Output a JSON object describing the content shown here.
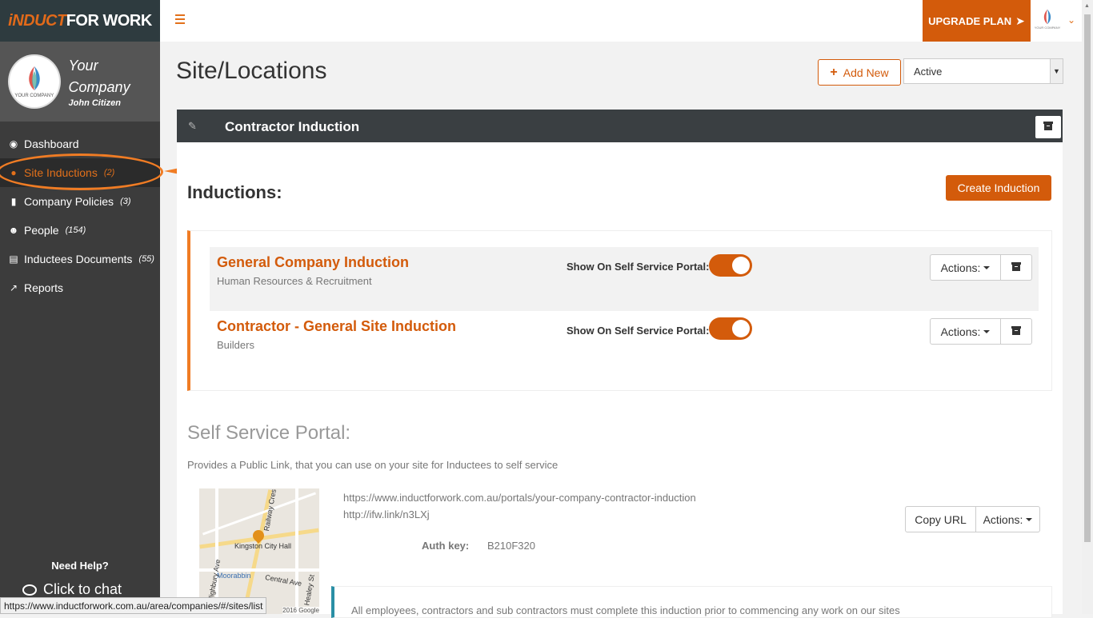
{
  "brand": {
    "part1": "iNDUCT",
    "part2": "FOR WORK"
  },
  "profile": {
    "company": "Your Company",
    "user": "John Citizen",
    "logo_text": "YOUR COMPANY"
  },
  "nav": [
    {
      "label": "Dashboard",
      "count": "",
      "icon": "dashboard-icon"
    },
    {
      "label": "Site Inductions",
      "count": "(2)",
      "icon": "map-marker-icon"
    },
    {
      "label": "Company Policies",
      "count": "(3)",
      "icon": "book-icon"
    },
    {
      "label": "People",
      "count": "(154)",
      "icon": "users-icon"
    },
    {
      "label": "Inductees Documents",
      "count": "(55)",
      "icon": "document-icon"
    },
    {
      "label": "Reports",
      "count": "",
      "icon": "chart-line-icon"
    }
  ],
  "help": {
    "title": "Need Help?",
    "chat": "Click to chat"
  },
  "statusbar": "https://www.inductforwork.com.au/area/companies/#/sites/list",
  "topbar": {
    "upgrade": "UPGRADE PLAN"
  },
  "page": {
    "title": "Site/Locations",
    "add_new": "Add New",
    "status_filter": "Active"
  },
  "panel": {
    "title": "Contractor Induction",
    "inductions_heading": "Inductions:",
    "create_button": "Create Induction",
    "items": [
      {
        "title": "General Company Induction",
        "subtitle": "Human Resources & Recruitment",
        "portal_label": "Show On Self Service Portal:",
        "portal_on": true,
        "actions": "Actions:"
      },
      {
        "title": "Contractor - General Site Induction",
        "subtitle": "Builders",
        "portal_label": "Show On Self Service Portal:",
        "portal_on": true,
        "actions": "Actions:"
      }
    ]
  },
  "portal": {
    "title": "Self Service Portal:",
    "description": "Provides a Public Link, that you can use on your site for Inductees to self service",
    "url": "https://www.inductforwork.com.au/portals/your-company-contractor-induction",
    "short_url": "http://ifw.link/n3LXj",
    "auth_label": "Auth key:",
    "auth_value": "B210F320",
    "copy_button": "Copy URL",
    "actions": "Actions:",
    "note": "All employees, contractors and sub contractors must complete this induction prior to commencing any work on our sites",
    "map": {
      "labels": [
        "Kingston City Hall",
        "Moorabbin",
        "Central Ave",
        "Highbury Ave",
        "Railway Cres",
        "Healey St"
      ],
      "copyright": "2016 Google"
    }
  },
  "colors": {
    "accent": "#d35b0b",
    "sidebar": "#3c3c3c",
    "panel_head": "#3a3f42",
    "note_border": "#2a8fa5"
  }
}
